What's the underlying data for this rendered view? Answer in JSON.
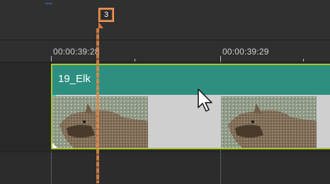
{
  "ruler": {
    "ticks": [
      "00:00:39:28",
      "00:00:39:29"
    ]
  },
  "marker": {
    "number": "3"
  },
  "clip": {
    "name": "19_Elk",
    "border_color": "#a8c62a",
    "title_bar_color": "#2c8f80"
  },
  "playhead": {
    "color": "#e58a48"
  },
  "icons": {
    "cursor": "mouse-pointer-arrow",
    "clip_start": "cyan-in-point-marker"
  }
}
